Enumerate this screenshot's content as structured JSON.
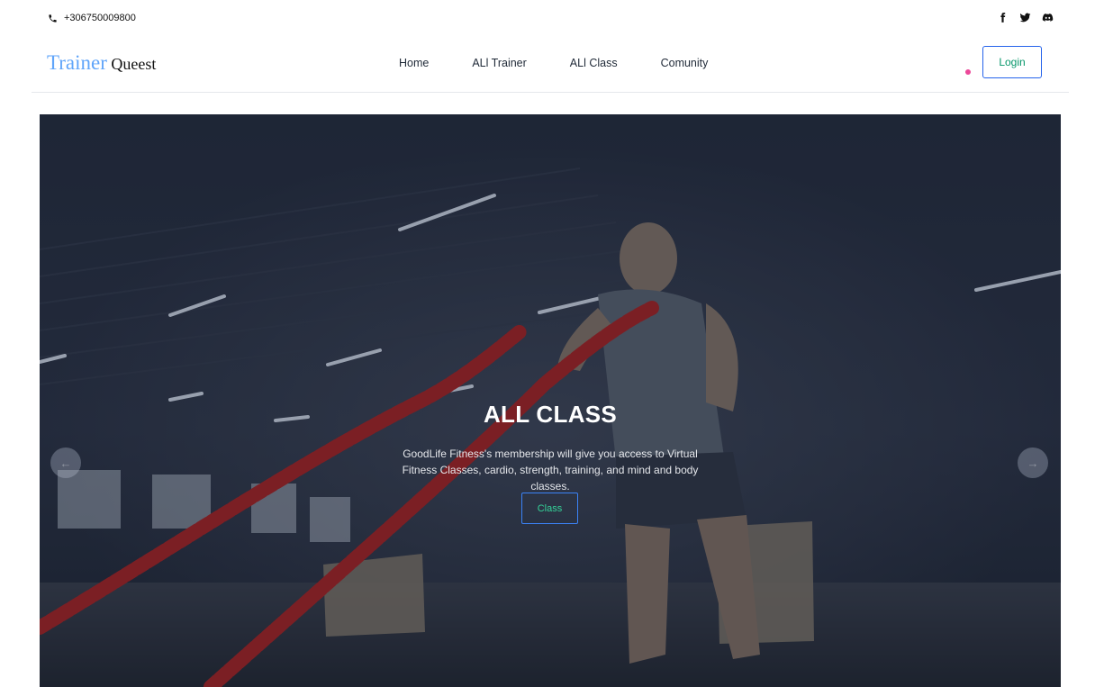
{
  "topbar": {
    "phone": "+306750009800",
    "icons": [
      "phone-icon",
      "facebook-icon",
      "twitter-icon",
      "discord-icon"
    ]
  },
  "nav": {
    "brand_first": "Trainer",
    "brand_second": "Queest",
    "links": [
      "Home",
      "ALl Trainer",
      "ALl Class",
      "Comunity"
    ],
    "login": "Login"
  },
  "hero": {
    "title": "ALL CLASS",
    "text": "GoodLife Fitness's membership will give you access to Virtual Fitness Classes, cardio, strength, training, and mind and body classes.",
    "button": "Class",
    "prev_icon": "←",
    "next_icon": "→"
  },
  "colors": {
    "brand_accent": "#60a5fa",
    "login_border": "#2563eb",
    "login_text": "#059669",
    "dot": "#ec4899",
    "class_button_text": "#34d399"
  }
}
